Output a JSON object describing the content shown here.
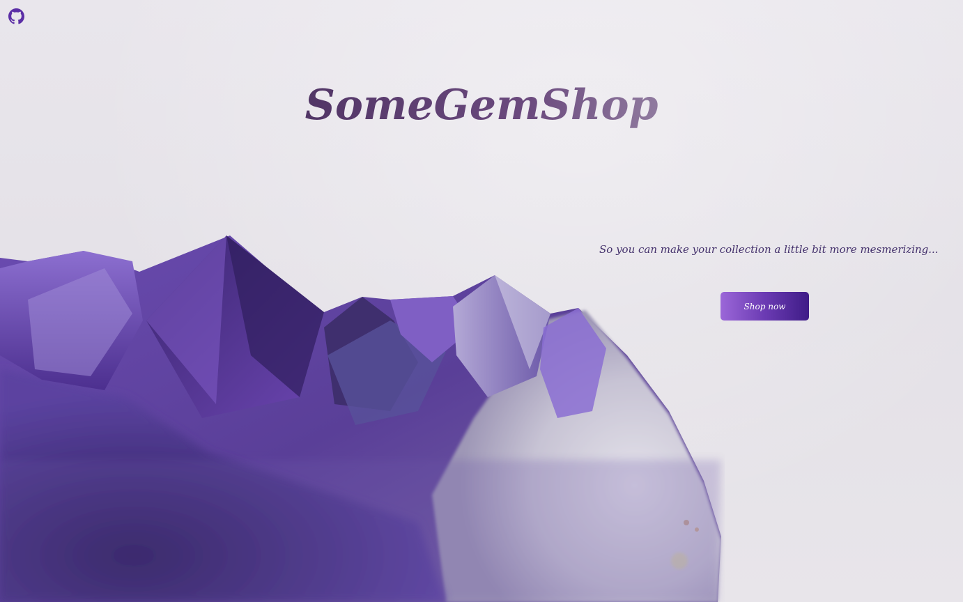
{
  "header": {
    "github_icon": "github-icon",
    "title": "SomeGemShop"
  },
  "hero": {
    "tagline": "So you can make your collection a little bit more mesmerizing...",
    "cta_label": "Shop now",
    "image_subject": "amethyst-crystal-cluster"
  },
  "colors": {
    "background": "#e6e3e9",
    "accent_start": "#9b67d8",
    "accent_end": "#3f1c87",
    "tagline": "#43306b",
    "github_icon": "#5b2ea6"
  }
}
